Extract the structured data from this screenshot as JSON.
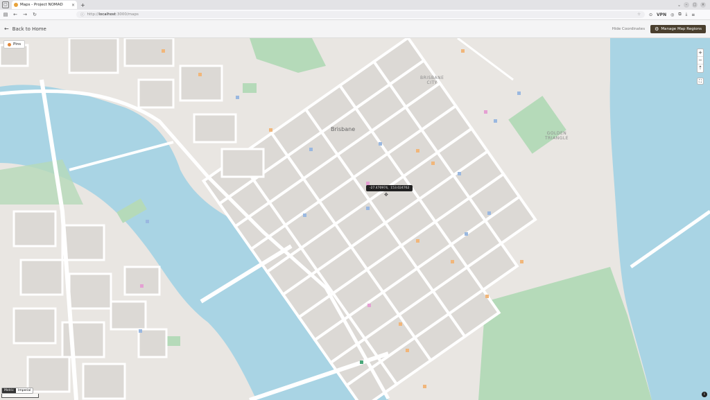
{
  "browser": {
    "tab_title": "Maps - Project NOMAD",
    "url_prefix": "http://",
    "url_host": "localhost",
    "url_rest": ":3000/maps",
    "vpn_label": "VPN"
  },
  "header": {
    "back_label": "Back to Home",
    "hide_coordinates_label": "Hide Coordinates",
    "manage_regions_label": "Manage Map Regions"
  },
  "map": {
    "pins_label": "Pins",
    "zoom_in": "+",
    "zoom_out": "−",
    "reset_north": "⇡",
    "fullscreen": "⛶",
    "coordinates": "-27.470974,  153.024762",
    "units": {
      "metric": "Metric",
      "imperial": "Imperial"
    },
    "scale_label": "",
    "info": "i",
    "labels": {
      "brisbane": "Brisbane",
      "brisbane_city": "BRISBANE\nCITY",
      "golden_triangle": "GOLDEN\nTRIANGLE"
    }
  },
  "colors": {
    "water": "#a9d4e4",
    "park": "#a8d5b0",
    "road": "#ffffff",
    "block": "#dedbd7",
    "accent": "#4a3f2e"
  }
}
